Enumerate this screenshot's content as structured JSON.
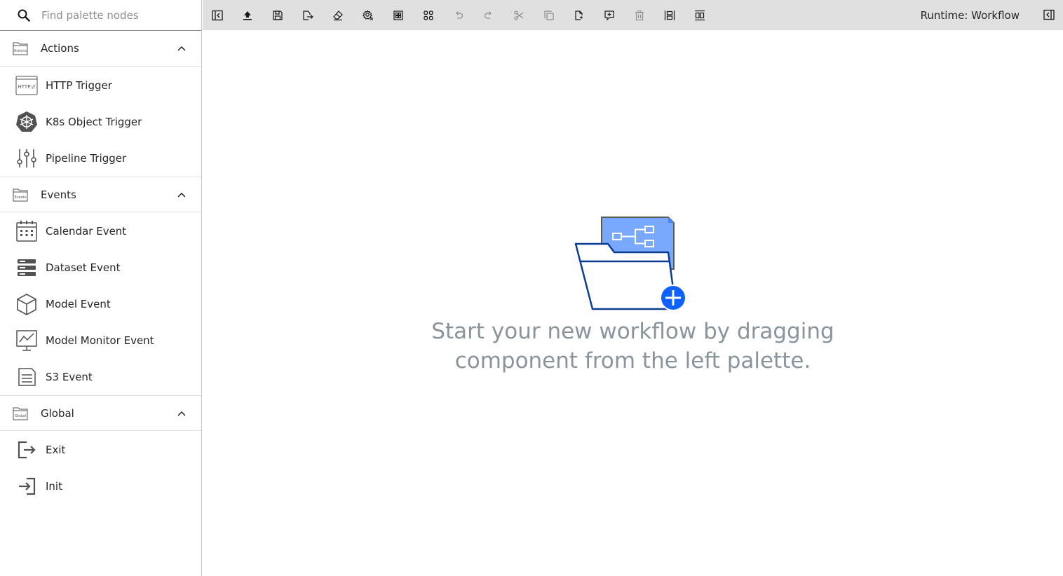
{
  "palette": {
    "search": {
      "placeholder": "Find palette nodes"
    },
    "categories": [
      {
        "label": "Actions",
        "icon_text": "Actions",
        "items": [
          {
            "label": "HTTP Trigger",
            "icon": "http-icon",
            "icon_text": "HTTP://"
          },
          {
            "label": "K8s Object Trigger",
            "icon": "kubernetes-icon"
          },
          {
            "label": "Pipeline Trigger",
            "icon": "sliders-icon"
          }
        ]
      },
      {
        "label": "Events",
        "icon_text": "Events",
        "items": [
          {
            "label": "Calendar Event",
            "icon": "calendar-icon"
          },
          {
            "label": "Dataset Event",
            "icon": "dataset-icon"
          },
          {
            "label": "Model Event",
            "icon": "cube-icon"
          },
          {
            "label": "Model Monitor Event",
            "icon": "monitor-chart-icon"
          },
          {
            "label": "S3 Event",
            "icon": "storage-icon"
          }
        ]
      },
      {
        "label": "Global",
        "icon_text": "Global",
        "items": [
          {
            "label": "Exit",
            "icon": "exit-icon"
          },
          {
            "label": "Init",
            "icon": "login-icon"
          }
        ]
      }
    ]
  },
  "toolbar": {
    "runtime_label": "Runtime: Workflow",
    "buttons": [
      "toggle-palette",
      "run",
      "save",
      "export",
      "clear",
      "settings",
      "open-runtimes",
      "arrange",
      "undo",
      "redo",
      "cut",
      "copy",
      "paste",
      "comment",
      "delete",
      "arrange-horizontal",
      "arrange-vertical"
    ]
  },
  "canvas": {
    "empty_line1": "Start your new workflow by dragging",
    "empty_line2": "component from the left palette."
  },
  "colors": {
    "accent": "#0f62fe",
    "folder_stroke": "#0b3d91",
    "file_fill": "#78a9ff",
    "muted_text": "#8a949c",
    "toolbar_bg": "#e0e0e0"
  }
}
